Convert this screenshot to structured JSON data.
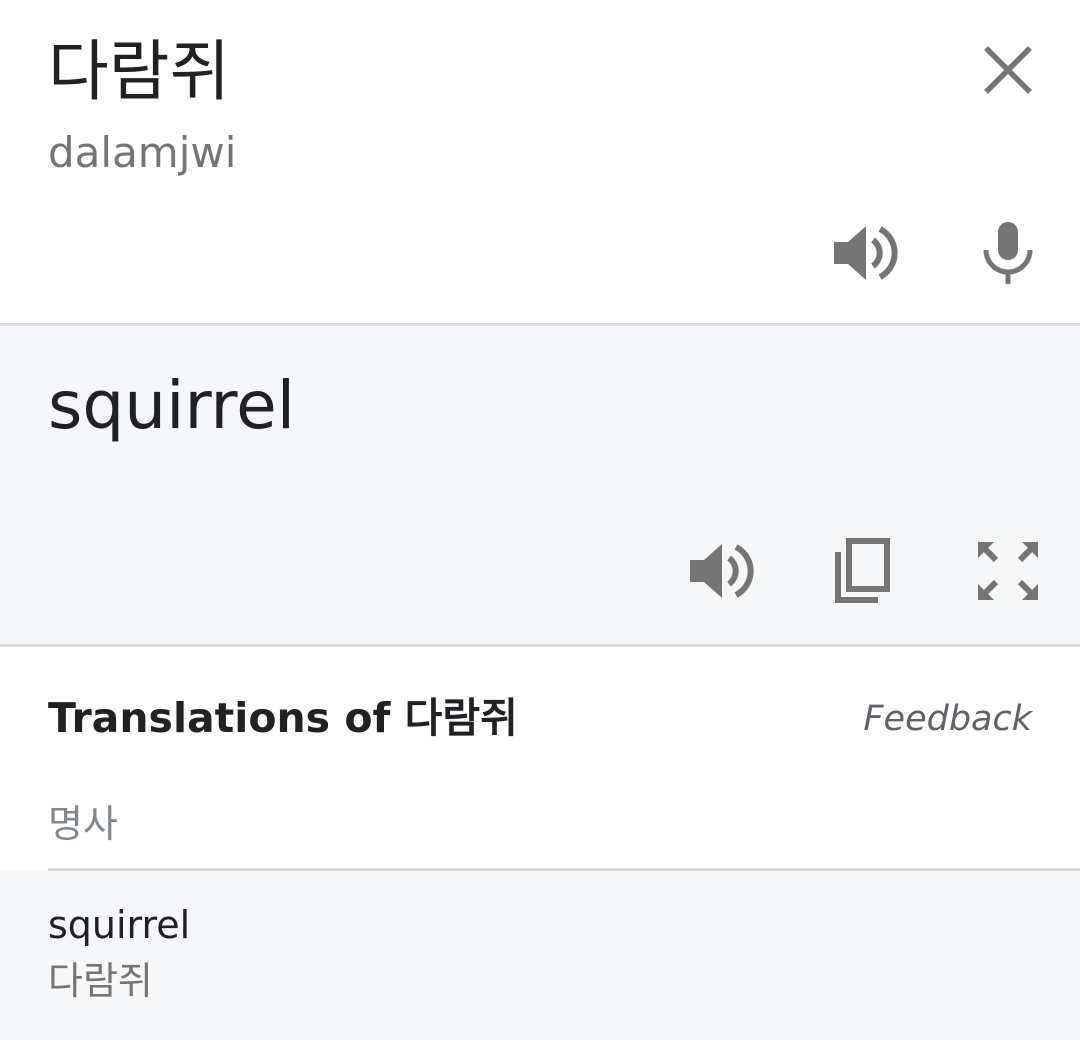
{
  "colors": {
    "text_primary": "#202124",
    "text_secondary": "#757575",
    "icon_gray": "#757575",
    "translation_background": "#f6f7f9",
    "divider": "#dadce0"
  },
  "source": {
    "text": "다람쥐",
    "transliteration": "dalamjwi",
    "icons": {
      "close": "close-icon",
      "speaker": "volume-up-icon",
      "mic": "microphone-icon"
    }
  },
  "translation": {
    "text": "squirrel",
    "icons": {
      "speaker": "volume-up-icon",
      "copy": "copy-icon",
      "fullscreen": "fullscreen-icon"
    }
  },
  "dictionary": {
    "title": "Translations of 다람쥐",
    "feedback_label": "Feedback",
    "part_of_speech": "명사",
    "entries": [
      {
        "word": "squirrel",
        "reverse": "다람쥐"
      }
    ]
  }
}
